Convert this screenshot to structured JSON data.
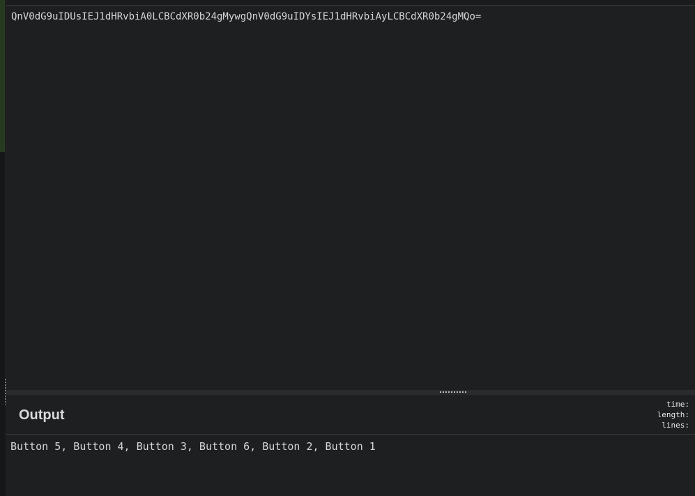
{
  "input": {
    "text": "QnV0dG9uIDUsIEJ1dHRvbiA0LCBCdXR0b24gMywgQnV0dG9uIDYsIEJ1dHRvbiAyLCBCdXR0b24gMQo="
  },
  "output": {
    "title": "Output",
    "stats": {
      "time_label": "time:",
      "length_label": "length:",
      "lines_label": "lines:"
    },
    "text": "Button 5, Button 4, Button 3, Button 6, Button 2, Button 1"
  },
  "colors": {
    "background": "#1e1f21",
    "text": "#d6d6d6",
    "gutter_accent": "#263a1f"
  }
}
